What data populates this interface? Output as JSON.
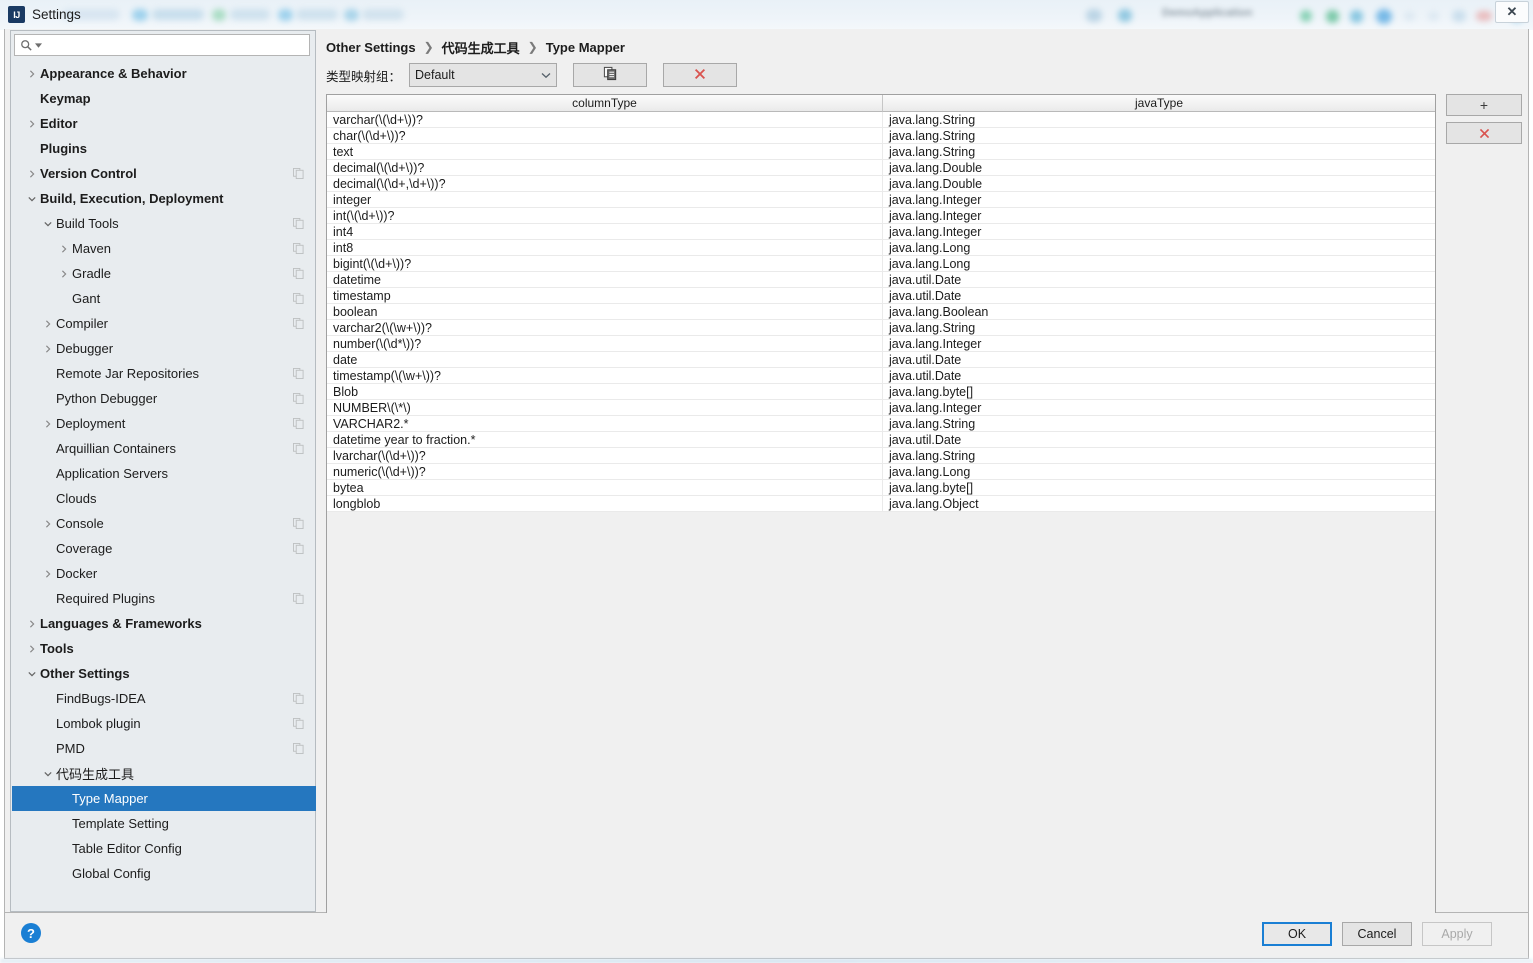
{
  "window": {
    "title": "Settings",
    "logo_text": "IJ"
  },
  "backdrop": {
    "blurred_app_label": "DemoApplication",
    "close_glyph": "✕"
  },
  "search": {
    "value": "",
    "placeholder": "",
    "icon": "search-icon"
  },
  "sidebar": {
    "items": [
      {
        "label": "Appearance & Behavior",
        "indent": 0,
        "twisty": "collapsed",
        "bold": true,
        "copy": false,
        "selected": false
      },
      {
        "label": "Keymap",
        "indent": 0,
        "twisty": "none",
        "bold": true,
        "copy": false,
        "selected": false
      },
      {
        "label": "Editor",
        "indent": 0,
        "twisty": "collapsed",
        "bold": true,
        "copy": false,
        "selected": false
      },
      {
        "label": "Plugins",
        "indent": 0,
        "twisty": "none",
        "bold": true,
        "copy": false,
        "selected": false
      },
      {
        "label": "Version Control",
        "indent": 0,
        "twisty": "collapsed",
        "bold": true,
        "copy": true,
        "selected": false
      },
      {
        "label": "Build, Execution, Deployment",
        "indent": 0,
        "twisty": "expanded",
        "bold": true,
        "copy": false,
        "selected": false
      },
      {
        "label": "Build Tools",
        "indent": 1,
        "twisty": "expanded",
        "bold": false,
        "copy": true,
        "selected": false
      },
      {
        "label": "Maven",
        "indent": 2,
        "twisty": "collapsed",
        "bold": false,
        "copy": true,
        "selected": false
      },
      {
        "label": "Gradle",
        "indent": 2,
        "twisty": "collapsed",
        "bold": false,
        "copy": true,
        "selected": false
      },
      {
        "label": "Gant",
        "indent": 2,
        "twisty": "none",
        "bold": false,
        "copy": true,
        "selected": false
      },
      {
        "label": "Compiler",
        "indent": 1,
        "twisty": "collapsed",
        "bold": false,
        "copy": true,
        "selected": false
      },
      {
        "label": "Debugger",
        "indent": 1,
        "twisty": "collapsed",
        "bold": false,
        "copy": false,
        "selected": false
      },
      {
        "label": "Remote Jar Repositories",
        "indent": 1,
        "twisty": "none",
        "bold": false,
        "copy": true,
        "selected": false
      },
      {
        "label": "Python Debugger",
        "indent": 1,
        "twisty": "none",
        "bold": false,
        "copy": true,
        "selected": false
      },
      {
        "label": "Deployment",
        "indent": 1,
        "twisty": "collapsed",
        "bold": false,
        "copy": true,
        "selected": false
      },
      {
        "label": "Arquillian Containers",
        "indent": 1,
        "twisty": "none",
        "bold": false,
        "copy": true,
        "selected": false
      },
      {
        "label": "Application Servers",
        "indent": 1,
        "twisty": "none",
        "bold": false,
        "copy": false,
        "selected": false
      },
      {
        "label": "Clouds",
        "indent": 1,
        "twisty": "none",
        "bold": false,
        "copy": false,
        "selected": false
      },
      {
        "label": "Console",
        "indent": 1,
        "twisty": "collapsed",
        "bold": false,
        "copy": true,
        "selected": false
      },
      {
        "label": "Coverage",
        "indent": 1,
        "twisty": "none",
        "bold": false,
        "copy": true,
        "selected": false
      },
      {
        "label": "Docker",
        "indent": 1,
        "twisty": "collapsed",
        "bold": false,
        "copy": false,
        "selected": false
      },
      {
        "label": "Required Plugins",
        "indent": 1,
        "twisty": "none",
        "bold": false,
        "copy": true,
        "selected": false
      },
      {
        "label": "Languages & Frameworks",
        "indent": 0,
        "twisty": "collapsed",
        "bold": true,
        "copy": false,
        "selected": false
      },
      {
        "label": "Tools",
        "indent": 0,
        "twisty": "collapsed",
        "bold": true,
        "copy": false,
        "selected": false
      },
      {
        "label": "Other Settings",
        "indent": 0,
        "twisty": "expanded",
        "bold": true,
        "copy": false,
        "selected": false
      },
      {
        "label": "FindBugs-IDEA",
        "indent": 1,
        "twisty": "none",
        "bold": false,
        "copy": true,
        "selected": false
      },
      {
        "label": "Lombok plugin",
        "indent": 1,
        "twisty": "none",
        "bold": false,
        "copy": true,
        "selected": false
      },
      {
        "label": "PMD",
        "indent": 1,
        "twisty": "none",
        "bold": false,
        "copy": true,
        "selected": false
      },
      {
        "label": "代码生成工具",
        "indent": 1,
        "twisty": "expanded",
        "bold": false,
        "copy": false,
        "selected": false
      },
      {
        "label": "Type Mapper",
        "indent": 2,
        "twisty": "none",
        "bold": false,
        "copy": false,
        "selected": true
      },
      {
        "label": "Template Setting",
        "indent": 2,
        "twisty": "none",
        "bold": false,
        "copy": false,
        "selected": false
      },
      {
        "label": "Table Editor Config",
        "indent": 2,
        "twisty": "none",
        "bold": false,
        "copy": false,
        "selected": false
      },
      {
        "label": "Global Config",
        "indent": 2,
        "twisty": "none",
        "bold": false,
        "copy": false,
        "selected": false
      }
    ]
  },
  "breadcrumb": {
    "items": [
      "Other Settings",
      "代码生成工具",
      "Type Mapper"
    ],
    "separator": "❯"
  },
  "toolbar": {
    "group_label": "类型映射组：",
    "group_selected": "Default",
    "group_options": [
      "Default"
    ],
    "copy_button_icon": "copy-icon",
    "delete_button_icon": "close-x-icon",
    "delete_color": "#d9534f"
  },
  "table": {
    "columns": [
      "columnType",
      "javaType"
    ],
    "rows": [
      [
        "varchar(\\(\\d+\\))?",
        "java.lang.String"
      ],
      [
        "char(\\(\\d+\\))?",
        "java.lang.String"
      ],
      [
        "text",
        "java.lang.String"
      ],
      [
        "decimal(\\(\\d+\\))?",
        "java.lang.Double"
      ],
      [
        "decimal(\\(\\d+,\\d+\\))?",
        "java.lang.Double"
      ],
      [
        "integer",
        "java.lang.Integer"
      ],
      [
        "int(\\(\\d+\\))?",
        "java.lang.Integer"
      ],
      [
        "int4",
        "java.lang.Integer"
      ],
      [
        "int8",
        "java.lang.Long"
      ],
      [
        "bigint(\\(\\d+\\))?",
        "java.lang.Long"
      ],
      [
        "datetime",
        "java.util.Date"
      ],
      [
        "timestamp",
        "java.util.Date"
      ],
      [
        "boolean",
        "java.lang.Boolean"
      ],
      [
        "varchar2(\\(\\w+\\))?",
        "java.lang.String"
      ],
      [
        "number(\\(\\d*\\))?",
        "java.lang.Integer"
      ],
      [
        "date",
        "java.util.Date"
      ],
      [
        "timestamp(\\(\\w+\\))?",
        "java.util.Date"
      ],
      [
        "Blob",
        "java.lang.byte[]"
      ],
      [
        "NUMBER\\(\\*\\)",
        "java.lang.Integer"
      ],
      [
        "VARCHAR2.*",
        "java.lang.String"
      ],
      [
        "datetime year to fraction.*",
        "java.util.Date"
      ],
      [
        "lvarchar(\\(\\d+\\))?",
        "java.lang.String"
      ],
      [
        "numeric(\\(\\d+\\))?",
        "java.lang.Long"
      ],
      [
        "bytea",
        "java.lang.byte[]"
      ],
      [
        "longblob",
        "java.lang.Object"
      ]
    ]
  },
  "side_actions": {
    "add_label": "+",
    "remove_label": "✕",
    "remove_color": "#d9534f"
  },
  "footer": {
    "help_label": "?",
    "ok_label": "OK",
    "cancel_label": "Cancel",
    "apply_label": "Apply"
  }
}
